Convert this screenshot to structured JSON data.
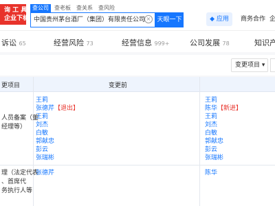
{
  "logo": {
    "line1": "询 工 具",
    "line2": "企业下机构"
  },
  "search": {
    "tabs": [
      "查公司",
      "查老板",
      "查关系",
      "查风险"
    ],
    "active_tab": 0,
    "value": "中国贵州茅台酒厂（集团）有限责任公司",
    "clear_icon": "clear-icon",
    "button_label": "天眼一下"
  },
  "header": {
    "app_label": "应用",
    "business_label": "商务合作",
    "extra_label": "企"
  },
  "nav": {
    "items": [
      {
        "label": "诉讼",
        "count": "65"
      },
      {
        "label": "经营风险",
        "count": "73"
      },
      {
        "label": "经营信息",
        "count": "999+"
      },
      {
        "label": "公司发展",
        "count": "78"
      },
      {
        "label": "知识产",
        "count": ""
      }
    ]
  },
  "filter": {
    "select_label": "变更项目 ▾"
  },
  "table": {
    "headers": [
      "更项目",
      "变更前"
    ],
    "rows": [
      {
        "item": "人员备案（董\n经理等）",
        "before": [
          {
            "name": "王莉",
            "tag": ""
          },
          {
            "name": "张德芹",
            "tag": "【退出】"
          },
          {
            "name": "王莉",
            "tag": ""
          },
          {
            "name": "刘杰",
            "tag": ""
          },
          {
            "name": "白敏",
            "tag": ""
          },
          {
            "name": "郭献忠",
            "tag": ""
          },
          {
            "name": "彭云",
            "tag": ""
          },
          {
            "name": "张瑞彬",
            "tag": ""
          }
        ],
        "after": [
          {
            "name": "王莉",
            "tag": ""
          },
          {
            "name": "陈华",
            "tag": "【新进】"
          },
          {
            "name": "王莉",
            "tag": ""
          },
          {
            "name": "刘杰",
            "tag": ""
          },
          {
            "name": "白敏",
            "tag": ""
          },
          {
            "name": "郭献忠",
            "tag": ""
          },
          {
            "name": "彭云",
            "tag": ""
          },
          {
            "name": "张瑞彬",
            "tag": ""
          }
        ]
      },
      {
        "item": "理（法定代表\n、首席代\n务执行人等",
        "before": [
          {
            "name": "张德芹",
            "tag": ""
          }
        ],
        "after": [
          {
            "name": "陈华",
            "tag": ""
          }
        ]
      }
    ]
  },
  "colors": {
    "accent": "#1677ff",
    "danger": "#e8332b",
    "header_bg": "#eef4fd"
  }
}
